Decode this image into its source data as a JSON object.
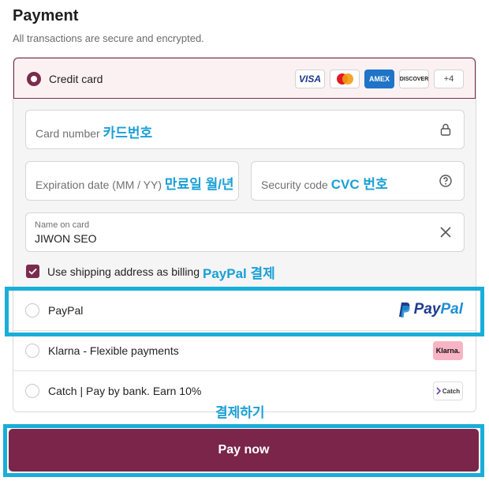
{
  "header": {
    "title": "Payment",
    "subtitle": "All transactions are secure and encrypted."
  },
  "credit_card": {
    "label": "Credit card",
    "brands": [
      "VISA",
      "",
      "AMEX",
      "DISCOVER"
    ],
    "more_brands": "+4",
    "card_number": {
      "placeholder": "Card number",
      "annotation": "카드번호"
    },
    "expiration": {
      "placeholder": "Expiration date (MM / YY)",
      "annotation": "만료일 월/년"
    },
    "security": {
      "placeholder": "Security code",
      "annotation": "CVC 번호"
    },
    "name": {
      "label": "Name on card",
      "value": "JIWON SEO"
    },
    "billing_checkbox": {
      "label": "Use shipping address as billing",
      "checked": true
    }
  },
  "options": {
    "paypal": {
      "label": "PayPal",
      "annotation": "PayPal 결제",
      "logo_text_a": "Pay",
      "logo_text_b": "Pal"
    },
    "klarna": {
      "label": "Klarna - Flexible payments",
      "logo": "Klarna."
    },
    "catch": {
      "label": "Catch | Pay by bank. Earn 10%",
      "logo": "Catch"
    }
  },
  "pay": {
    "annotation": "결제하기",
    "button_label": "Pay now"
  },
  "colors": {
    "accent": "#7a2549",
    "highlight": "#19aed8",
    "annotation_text": "#1aa0d6"
  }
}
